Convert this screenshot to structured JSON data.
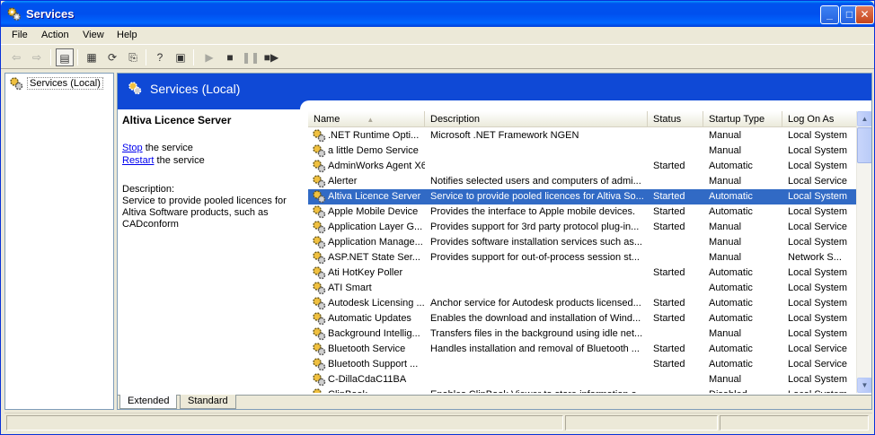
{
  "window": {
    "title": "Services",
    "buttons": {
      "minimize": "_",
      "maximize": "□",
      "close": "✕"
    }
  },
  "menu": [
    "File",
    "Action",
    "View",
    "Help"
  ],
  "toolbar": {
    "icons": [
      "back-arrow-icon",
      "forward-arrow-icon",
      "show-hide-tree-icon",
      "properties-icon",
      "refresh-icon",
      "export-list-icon",
      "help-icon",
      "console-icon",
      "play-icon",
      "stop-icon",
      "pause-icon",
      "restart-icon"
    ]
  },
  "tree": {
    "root_label": "Services (Local)"
  },
  "banner": {
    "title": "Services (Local)"
  },
  "details": {
    "service_name": "Altiva Licence Server",
    "stop_link": "Stop",
    "stop_suffix": " the service",
    "restart_link": "Restart",
    "restart_suffix": " the service",
    "description_label": "Description:",
    "description_text": "Service to provide pooled licences for Altiva Software products, such as CADconform"
  },
  "columns": [
    "Name",
    "Description",
    "Status",
    "Startup Type",
    "Log On As"
  ],
  "selected_row": 4,
  "rows": [
    {
      "name": ".NET Runtime Opti...",
      "description": "Microsoft .NET Framework NGEN",
      "status": "",
      "startup": "Manual",
      "logon": "Local System"
    },
    {
      "name": "a little Demo Service",
      "description": "",
      "status": "",
      "startup": "Manual",
      "logon": "Local System"
    },
    {
      "name": "AdminWorks Agent X6",
      "description": "",
      "status": "Started",
      "startup": "Automatic",
      "logon": "Local System"
    },
    {
      "name": "Alerter",
      "description": "Notifies selected users and computers of admi...",
      "status": "",
      "startup": "Manual",
      "logon": "Local Service"
    },
    {
      "name": "Altiva Licence Server",
      "description": "Service to provide pooled licences for Altiva So...",
      "status": "Started",
      "startup": "Automatic",
      "logon": "Local System"
    },
    {
      "name": "Apple Mobile Device",
      "description": "Provides the interface to Apple mobile devices.",
      "status": "Started",
      "startup": "Automatic",
      "logon": "Local System"
    },
    {
      "name": "Application Layer G...",
      "description": "Provides support for 3rd party protocol plug-in...",
      "status": "Started",
      "startup": "Manual",
      "logon": "Local Service"
    },
    {
      "name": "Application Manage...",
      "description": "Provides software installation services such as...",
      "status": "",
      "startup": "Manual",
      "logon": "Local System"
    },
    {
      "name": "ASP.NET State Ser...",
      "description": "Provides support for out-of-process session st...",
      "status": "",
      "startup": "Manual",
      "logon": "Network S..."
    },
    {
      "name": "Ati HotKey Poller",
      "description": "",
      "status": "Started",
      "startup": "Automatic",
      "logon": "Local System"
    },
    {
      "name": "ATI Smart",
      "description": "",
      "status": "",
      "startup": "Automatic",
      "logon": "Local System"
    },
    {
      "name": "Autodesk Licensing ...",
      "description": "Anchor service for Autodesk products licensed...",
      "status": "Started",
      "startup": "Automatic",
      "logon": "Local System"
    },
    {
      "name": "Automatic Updates",
      "description": "Enables the download and installation of Wind...",
      "status": "Started",
      "startup": "Automatic",
      "logon": "Local System"
    },
    {
      "name": "Background Intellig...",
      "description": "Transfers files in the background using idle net...",
      "status": "",
      "startup": "Manual",
      "logon": "Local System"
    },
    {
      "name": "Bluetooth Service",
      "description": "Handles installation and removal of Bluetooth ...",
      "status": "Started",
      "startup": "Automatic",
      "logon": "Local Service"
    },
    {
      "name": "Bluetooth Support ...",
      "description": "",
      "status": "Started",
      "startup": "Automatic",
      "logon": "Local Service"
    },
    {
      "name": "C-DillaCdaC11BA",
      "description": "",
      "status": "",
      "startup": "Manual",
      "logon": "Local System"
    },
    {
      "name": "ClipBook",
      "description": "Enables ClipBook Viewer to store information a...",
      "status": "",
      "startup": "Disabled",
      "logon": "Local System"
    }
  ],
  "tabs": [
    "Extended",
    "Standard"
  ],
  "colors": {
    "banner": "#0f49d6",
    "selection": "#316ac5",
    "titlebar": "#0053ee"
  }
}
